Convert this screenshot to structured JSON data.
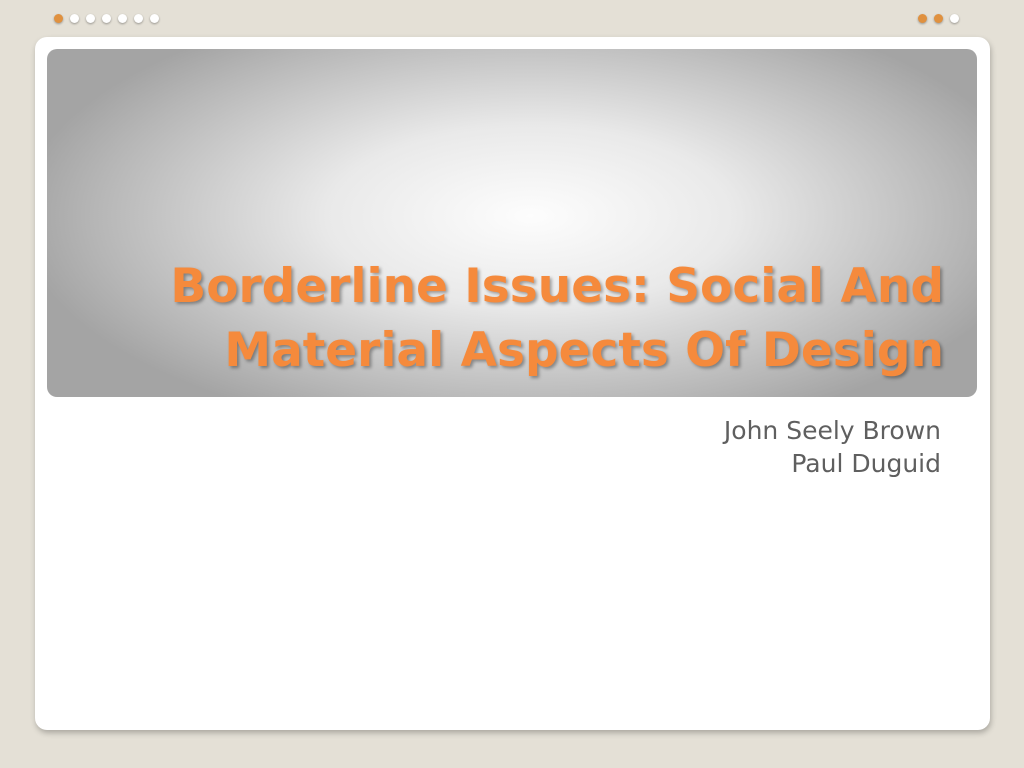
{
  "slide": {
    "title_lines": [
      "Borderline Issues: Social And",
      "Material Aspects Of Design"
    ],
    "authors": [
      "John Seely Brown",
      "Paul Duguid"
    ]
  },
  "decoration": {
    "dots_left": [
      "accent",
      "plain",
      "plain",
      "plain",
      "plain",
      "plain",
      "plain"
    ],
    "dots_right": [
      "accent",
      "accent",
      "plain"
    ]
  },
  "colors": {
    "title": "#f58a3c",
    "accent_dot": "#e0913f",
    "background": "#e4e0d6",
    "subtitle": "#5f5f5f"
  }
}
